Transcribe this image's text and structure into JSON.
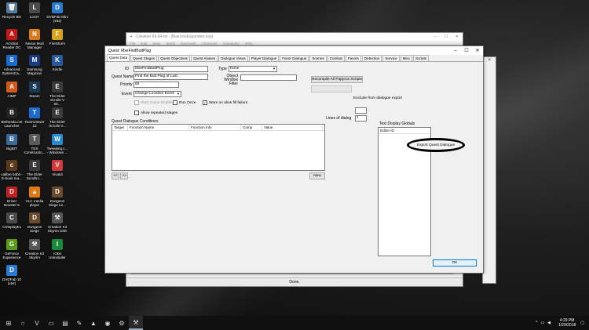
{
  "desktop": {
    "icons": [
      {
        "label": "Recycle Bin",
        "glyph": "🗑",
        "color": "#5a7a9a"
      },
      {
        "label": "LOOT",
        "glyph": "L",
        "color": "#4a4a4a"
      },
      {
        "label": "DVDFab Mini (x64)",
        "glyph": "D",
        "color": "#2a7ad0"
      },
      {
        "label": "Acrobat Reader DC",
        "glyph": "A",
        "color": "#c21a1a"
      },
      {
        "label": "Nexus Mod Manager",
        "glyph": "N",
        "color": "#d87a1a"
      },
      {
        "label": "FireStorm",
        "glyph": "F",
        "color": "#d8a21a"
      },
      {
        "label": "Advanced SystemCa...",
        "glyph": "S",
        "color": "#1a6ad0"
      },
      {
        "label": "Samsung Magician",
        "glyph": "M",
        "color": "#1a3a80"
      },
      {
        "label": "Kindle",
        "glyph": "K",
        "color": "#2a5a9a"
      },
      {
        "label": "AIMP",
        "glyph": "A",
        "color": "#d05a1a"
      },
      {
        "label": "Steam",
        "glyph": "S",
        "color": "#1a3a5a"
      },
      {
        "label": "The Elder Scrolls V Sk...",
        "glyph": "E",
        "color": "#3a3a3a"
      },
      {
        "label": "Bethesda.net Launcher",
        "glyph": "B",
        "color": "#222222"
      },
      {
        "label": "TeamViewer 13",
        "glyph": "T",
        "color": "#1a6ad0"
      },
      {
        "label": "The Elder Scrolls V...",
        "glyph": "E",
        "color": "#3a3a3a"
      },
      {
        "label": "BigBIT",
        "glyph": "B",
        "color": "#3a6a9a"
      },
      {
        "label": "TES Constructio...",
        "glyph": "T",
        "color": "#5a5a5a"
      },
      {
        "label": "Tweaking.c... - Windows ...",
        "glyph": "W",
        "color": "#2a8ad0"
      },
      {
        "label": "calibre 64bit - E-book ma...",
        "glyph": "c",
        "color": "#5a3a1a"
      },
      {
        "label": "The Elder Scrolls I...",
        "glyph": "E",
        "color": "#3a3a3a"
      },
      {
        "label": "Vivaldi",
        "glyph": "V",
        "color": "#d03a3a"
      },
      {
        "label": "Driver Booster 5",
        "glyph": "D",
        "color": "#c02020"
      },
      {
        "label": "VLC media player",
        "glyph": "▲",
        "color": "#e07a10"
      },
      {
        "label": "Dungeon Siege Le...",
        "glyph": "D",
        "color": "#6a4a2a"
      },
      {
        "label": "CDisplayEx",
        "glyph": "C",
        "color": "#4a4a4a"
      },
      {
        "label": "Dungeon Siege",
        "glyph": "D",
        "color": "#6a4a2a"
      },
      {
        "label": "Creation Kit Skyrim SSE",
        "glyph": "⚒",
        "color": "#555555"
      },
      {
        "label": "GeForce Experience",
        "glyph": "G",
        "color": "#5a9a1a"
      },
      {
        "label": "Creation Kit Skyrim",
        "glyph": "⚒",
        "color": "#555555"
      },
      {
        "label": "IObit Uninstaller",
        "glyph": "I",
        "color": "#1a8a3a"
      },
      {
        "label": "DVDFab 10 (x64)",
        "glyph": "D",
        "color": "#2a7ad0"
      }
    ]
  },
  "bg_window": {
    "title": "Creation Kit 64-bit - [MaxLewExpanded.esp]",
    "menu": [
      "File",
      "Edit",
      "View",
      "World",
      "Navmesh",
      "Character",
      "Gameplay",
      "Help"
    ],
    "status": "Done."
  },
  "dialog": {
    "title": "Quest: MxeFindButtPlug",
    "tabs": [
      "Quest Data",
      "Quest Stages",
      "Quest Objectives",
      "Quest Aliases",
      "Dialogue Views",
      "Player Dialogue",
      "Favor Dialogue",
      "Scenes",
      "Combat",
      "Favors",
      "Detection",
      "Service",
      "Misc",
      "Scripts"
    ],
    "id_label": "ID",
    "id_value": "MxeFindButtPlug",
    "quest_name_label": "Quest Name",
    "quest_name_value": "Find the Butt Plug of Lust",
    "priority_label": "Priority",
    "priority_value": "60",
    "event_label": "Event",
    "event_value": "Change Location Event",
    "type_label": "Type",
    "type_value": "None",
    "object_window_filter_label": "Object Window Filter",
    "object_window_filter_value": "",
    "start_game_enabled": "Start Game Enabled",
    "run_once": "Run Once",
    "warn_alias_fill": "Warn on alias fill failure",
    "allow_repeated": "Allow repeated stages",
    "conditions_label": "Quest Dialogue Conditions",
    "cond_cols": [
      "Target",
      "Function Name",
      "Function Info",
      "Comp",
      "Value"
    ],
    "new_button": "New",
    "prev_button": "<<",
    "next_button": ">>",
    "recompile_button": "Recompile All Papyrus Scripts",
    "export_button": "Export Quest Dialogue",
    "exclude_label": "Exclude from dialogue export",
    "lines_label": "Lines of dialog",
    "lines_value": "1",
    "text_globals_label": "Text Display Globals",
    "editor_id_col": "Editor ID",
    "ok_button": "OK"
  },
  "taskbar": {
    "time": "4:29 PM",
    "date": "1/29/2018",
    "icons": [
      {
        "glyph": "⊞",
        "name": "start-icon"
      },
      {
        "glyph": "○",
        "name": "search-icon"
      },
      {
        "glyph": "V",
        "name": "vivaldi-icon"
      },
      {
        "glyph": "▭",
        "name": "task-view-icon"
      },
      {
        "glyph": "▤",
        "name": "file-explorer-icon"
      },
      {
        "glyph": "✎",
        "name": "notepad-icon"
      },
      {
        "glyph": "▲",
        "name": "vlc-icon"
      },
      {
        "glyph": "◉",
        "name": "edge-icon"
      },
      {
        "glyph": "⚙",
        "name": "settings-icon"
      },
      {
        "glyph": "⚒",
        "name": "creation-kit-icon"
      }
    ]
  }
}
